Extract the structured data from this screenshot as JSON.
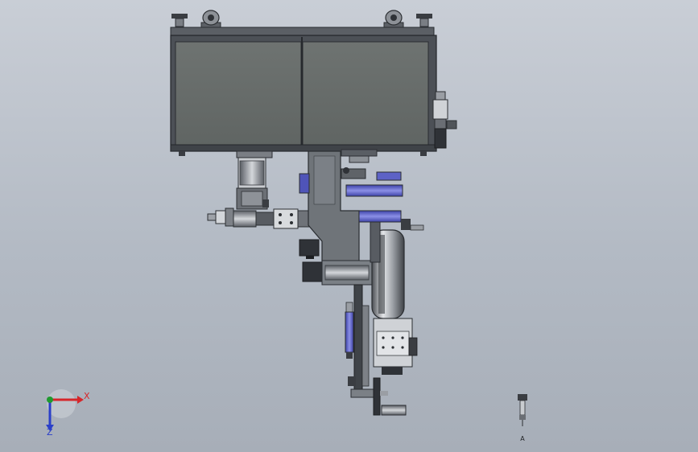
{
  "triad": {
    "x_label": "X",
    "z_label": "Z",
    "colors": {
      "x": "#d6262a",
      "y": "#1f9a2f",
      "z": "#2a3fc9"
    }
  },
  "part_label": "A",
  "colors": {
    "frame": "#4b4f55",
    "panel": "#6b706f",
    "steel": "#8d9299",
    "steel_light": "#c8ccd1",
    "dark": "#2f3237",
    "accent_blue": "#5a5fc7"
  }
}
